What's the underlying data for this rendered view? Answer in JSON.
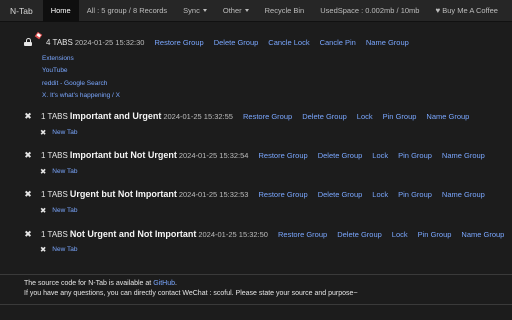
{
  "nav": {
    "brand": "N-Tab",
    "home": "Home",
    "all": "All : 5 group / 8 Records",
    "sync": "Sync",
    "other": "Other",
    "recycle": "Recycle Bin",
    "used": "UsedSpace : 0.002mb / 10mb",
    "coffee": "Buy Me A Coffee"
  },
  "groups": [
    {
      "count": "4 TABS",
      "name": "",
      "date": "2024-01-25 15:32:30",
      "locked": true,
      "pinned": true,
      "actions": [
        "Restore Group",
        "Delete Group",
        "Cancle Lock",
        "Cancle Pin",
        "Name Group"
      ],
      "tabs": [
        "Extensions",
        "YouTube",
        "reddit - Google Search",
        "X. It's what's happening / X"
      ]
    },
    {
      "count": "1 TABS",
      "name": "Important and Urgent",
      "date": "2024-01-25 15:32:55",
      "locked": false,
      "actions": [
        "Restore Group",
        "Delete Group",
        "Lock",
        "Pin Group",
        "Name Group"
      ],
      "tabs": [
        "New Tab"
      ]
    },
    {
      "count": "1 TABS",
      "name": "Important but Not Urgent",
      "date": "2024-01-25 15:32:54",
      "locked": false,
      "actions": [
        "Restore Group",
        "Delete Group",
        "Lock",
        "Pin Group",
        "Name Group"
      ],
      "tabs": [
        "New Tab"
      ]
    },
    {
      "count": "1 TABS",
      "name": "Urgent but Not Important",
      "date": "2024-01-25 15:32:53",
      "locked": false,
      "actions": [
        "Restore Group",
        "Delete Group",
        "Lock",
        "Pin Group",
        "Name Group"
      ],
      "tabs": [
        "New Tab"
      ]
    },
    {
      "count": "1 TABS",
      "name": "Not Urgent and Not Important",
      "date": "2024-01-25 15:32:50",
      "locked": false,
      "actions": [
        "Restore Group",
        "Delete Group",
        "Lock",
        "Pin Group",
        "Name Group"
      ],
      "tabs": [
        "New Tab"
      ]
    }
  ],
  "footer": {
    "line1_prefix": "The source code for N-Tab is available at",
    "line1_link": "GitHub",
    "line1_suffix": ".",
    "line2": "If you have any questions, you can directly contact WeChat : scoful. Please state your source and purpose~"
  }
}
